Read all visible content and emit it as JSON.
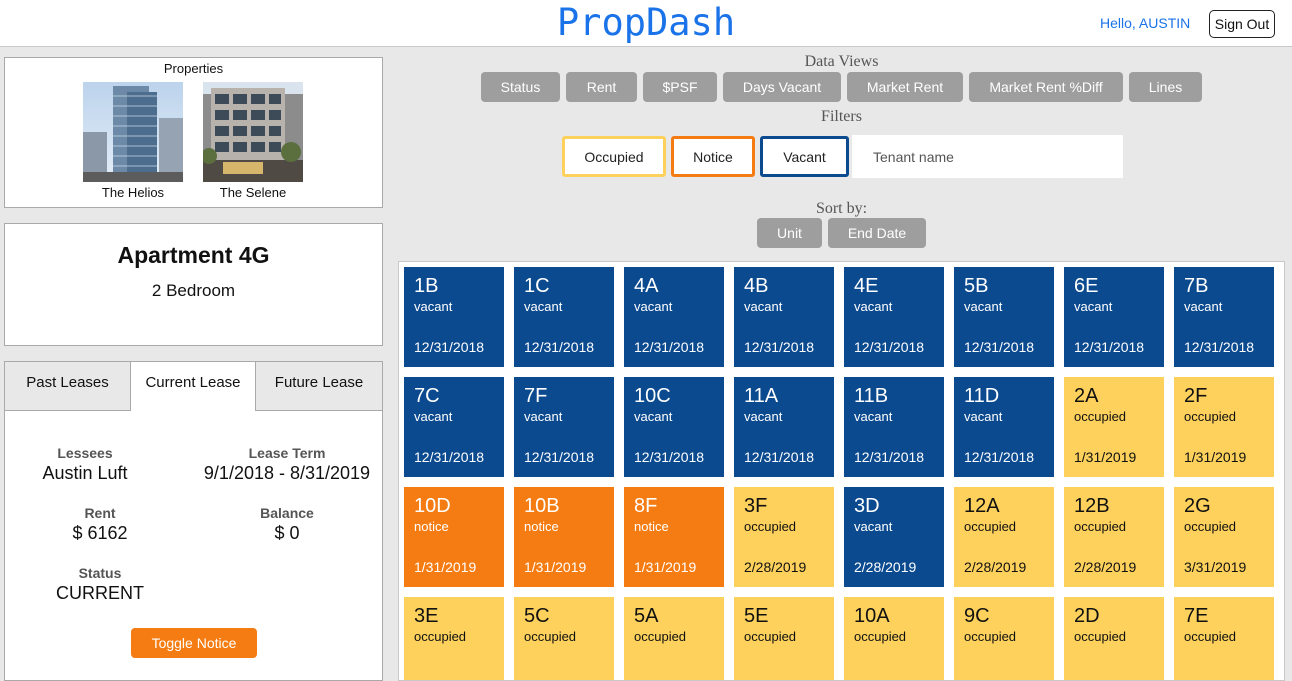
{
  "header": {
    "logo": "PropDash",
    "greeting": "Hello, AUSTIN",
    "signout_label": "Sign Out"
  },
  "properties": {
    "title": "Properties",
    "items": [
      {
        "name": "The Helios"
      },
      {
        "name": "The Selene"
      }
    ]
  },
  "apartment": {
    "name": "Apartment 4G",
    "bedrooms": "2 Bedroom"
  },
  "lease": {
    "tabs": [
      "Past Leases",
      "Current Lease",
      "Future Lease"
    ],
    "active_tab": "Current Lease",
    "lessees_label": "Lessees",
    "lessees": "Austin Luft",
    "term_label": "Lease Term",
    "term": "9/1/2018 - 8/31/2019",
    "rent_label": "Rent",
    "rent": "$ 6162",
    "balance_label": "Balance",
    "balance": "$ 0",
    "status_label": "Status",
    "status": "CURRENT",
    "toggle_label": "Toggle Notice"
  },
  "data_views": {
    "title": "Data Views",
    "buttons": [
      "Status",
      "Rent",
      "$PSF",
      "Days Vacant",
      "Market Rent",
      "Market Rent %Diff",
      "Lines"
    ]
  },
  "filters": {
    "title": "Filters",
    "occupied": "Occupied",
    "notice": "Notice",
    "vacant": "Vacant",
    "tenant_placeholder": "Tenant name"
  },
  "sort": {
    "title": "Sort by:",
    "unit": "Unit",
    "end_date": "End Date"
  },
  "colors": {
    "vacant": "#0b4a8f",
    "occupied": "#fdd15c",
    "notice": "#f57c12",
    "accent": "#1a73e8",
    "button_gray": "#9e9e9e"
  },
  "units": [
    {
      "unit": "1B",
      "status": "vacant",
      "date": "12/31/2018"
    },
    {
      "unit": "1C",
      "status": "vacant",
      "date": "12/31/2018"
    },
    {
      "unit": "4A",
      "status": "vacant",
      "date": "12/31/2018"
    },
    {
      "unit": "4B",
      "status": "vacant",
      "date": "12/31/2018"
    },
    {
      "unit": "4E",
      "status": "vacant",
      "date": "12/31/2018"
    },
    {
      "unit": "5B",
      "status": "vacant",
      "date": "12/31/2018"
    },
    {
      "unit": "6E",
      "status": "vacant",
      "date": "12/31/2018"
    },
    {
      "unit": "7B",
      "status": "vacant",
      "date": "12/31/2018"
    },
    {
      "unit": "7C",
      "status": "vacant",
      "date": "12/31/2018"
    },
    {
      "unit": "7F",
      "status": "vacant",
      "date": "12/31/2018"
    },
    {
      "unit": "10C",
      "status": "vacant",
      "date": "12/31/2018"
    },
    {
      "unit": "11A",
      "status": "vacant",
      "date": "12/31/2018"
    },
    {
      "unit": "11B",
      "status": "vacant",
      "date": "12/31/2018"
    },
    {
      "unit": "11D",
      "status": "vacant",
      "date": "12/31/2018"
    },
    {
      "unit": "2A",
      "status": "occupied",
      "date": "1/31/2019"
    },
    {
      "unit": "2F",
      "status": "occupied",
      "date": "1/31/2019"
    },
    {
      "unit": "10D",
      "status": "notice",
      "date": "1/31/2019"
    },
    {
      "unit": "10B",
      "status": "notice",
      "date": "1/31/2019"
    },
    {
      "unit": "8F",
      "status": "notice",
      "date": "1/31/2019"
    },
    {
      "unit": "3F",
      "status": "occupied",
      "date": "2/28/2019"
    },
    {
      "unit": "3D",
      "status": "vacant",
      "date": "2/28/2019"
    },
    {
      "unit": "12A",
      "status": "occupied",
      "date": "2/28/2019"
    },
    {
      "unit": "12B",
      "status": "occupied",
      "date": "2/28/2019"
    },
    {
      "unit": "2G",
      "status": "occupied",
      "date": "3/31/2019"
    },
    {
      "unit": "3E",
      "status": "occupied",
      "date": ""
    },
    {
      "unit": "5C",
      "status": "occupied",
      "date": ""
    },
    {
      "unit": "5A",
      "status": "occupied",
      "date": ""
    },
    {
      "unit": "5E",
      "status": "occupied",
      "date": ""
    },
    {
      "unit": "10A",
      "status": "occupied",
      "date": ""
    },
    {
      "unit": "9C",
      "status": "occupied",
      "date": ""
    },
    {
      "unit": "2D",
      "status": "occupied",
      "date": ""
    },
    {
      "unit": "7E",
      "status": "occupied",
      "date": ""
    }
  ]
}
